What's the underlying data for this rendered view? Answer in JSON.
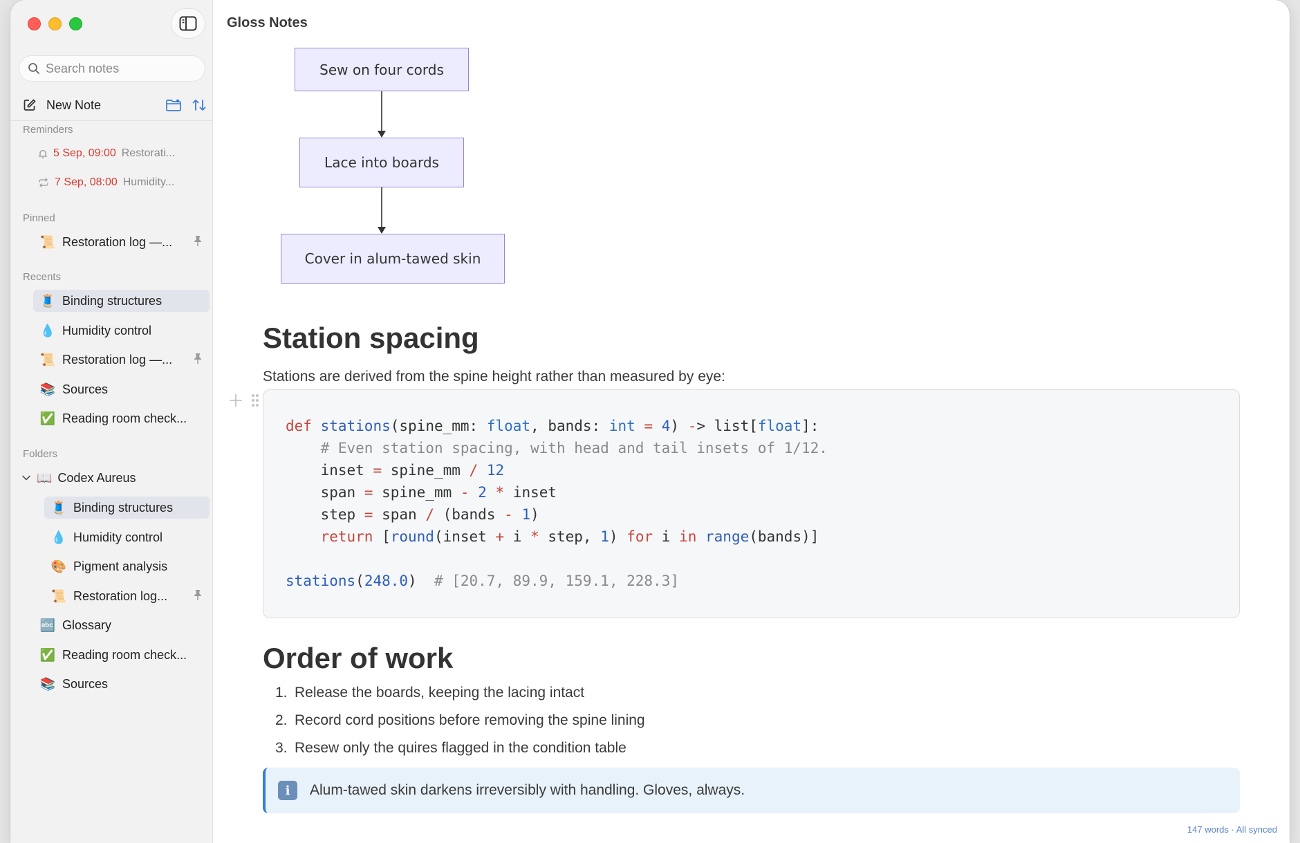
{
  "app": {
    "title": "Gloss Notes"
  },
  "sidebar": {
    "search": {
      "placeholder": "Search notes"
    },
    "new_note_label": "New Note",
    "sections": {
      "reminders": "Reminders",
      "pinned": "Pinned",
      "recents": "Recents",
      "folders": "Folders"
    },
    "reminders": [
      {
        "icon": "bell-icon",
        "when": "5 Sep, 09:00",
        "title": "Restorati..."
      },
      {
        "icon": "repeat-icon",
        "when": "7 Sep, 08:00",
        "title": "Humidity..."
      }
    ],
    "pinned": [
      {
        "emoji": "📜",
        "label": "Restoration log —...",
        "pinned": true
      }
    ],
    "recents": [
      {
        "emoji": "🧵",
        "label": "Binding structures",
        "selected": true
      },
      {
        "emoji": "💧",
        "label": "Humidity control"
      },
      {
        "emoji": "📜",
        "label": "Restoration log —...",
        "pinned": true
      },
      {
        "emoji": "📚",
        "label": "Sources"
      },
      {
        "emoji": "✅",
        "label": "Reading room check..."
      }
    ],
    "folder": {
      "emoji": "📖",
      "name": "Codex Aureus",
      "children": [
        {
          "emoji": "🧵",
          "label": "Binding structures",
          "selected": true
        },
        {
          "emoji": "💧",
          "label": "Humidity control"
        },
        {
          "emoji": "🎨",
          "label": "Pigment analysis"
        },
        {
          "emoji": "📜",
          "label": "Restoration log...",
          "pinned": true
        }
      ]
    },
    "loose_notes": [
      {
        "emoji": "🔤",
        "label": "Glossary"
      },
      {
        "emoji": "✅",
        "label": "Reading room check..."
      },
      {
        "emoji": "📚",
        "label": "Sources"
      }
    ]
  },
  "document": {
    "flowchart": {
      "nodes": [
        "Sew on four cords",
        "Lace into boards",
        "Cover in alum-tawed skin"
      ]
    },
    "section1": {
      "heading": "Station spacing",
      "intro": "Stations are derived from the spine height rather than measured by eye:"
    },
    "code_lines": [
      "def stations(spine_mm: float, bands: int = 4) -> list[float]:",
      "    # Even station spacing, with head and tail insets of 1/12.",
      "    inset = spine_mm / 12",
      "    span = spine_mm - 2 * inset",
      "    step = span / (bands - 1)",
      "    return [round(inset + i * step, 1) for i in range(bands)]",
      "",
      "stations(248.0)  # [20.7, 89.9, 159.1, 228.3]"
    ],
    "section2": {
      "heading": "Order of work",
      "items": [
        "Release the boards, keeping the lacing intact",
        "Record cord positions before removing the spine lining",
        "Resew only the quires flagged in the condition table"
      ]
    },
    "callout": "Alum-tawed skin darkens irreversibly with handling. Gloves, always."
  },
  "status": "147 words · All synced",
  "colors": {
    "accent": "#3a7bd5",
    "reminder_red": "#d8392f",
    "flow_fill": "#ececfe",
    "flow_border": "#9686d3"
  }
}
